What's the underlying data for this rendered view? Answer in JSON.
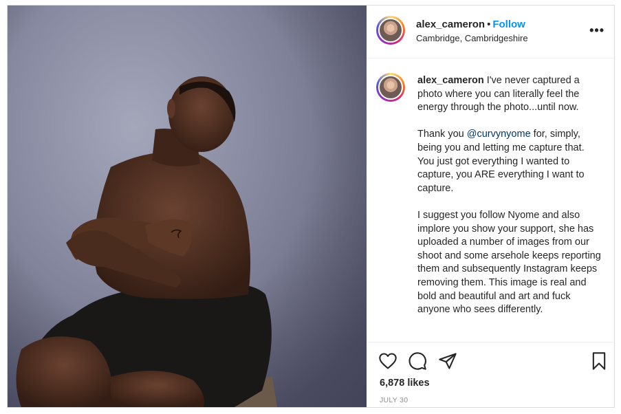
{
  "header": {
    "username": "alex_cameron",
    "separator": "•",
    "follow_label": "Follow",
    "location": "Cambridge, Cambridgeshire",
    "more_label": "•••"
  },
  "caption": {
    "username": "alex_cameron",
    "p1": " I've never captured a photo where you can literally feel the energy through the photo...until now.",
    "p2_before": "Thank you ",
    "mention": "@curvynyome",
    "p2_after": " for, simply, being you and letting me capture that. You just got everything I wanted to capture, you ARE everything I want to capture.",
    "p3": "I suggest you follow Nyome and also implore you show your support, she has uploaded a number of images from our shoot and some arsehole keeps reporting them and subsequently Instagram keeps removing them. This image is real and bold and beautiful and art and fuck anyone who sees differently."
  },
  "stats": {
    "likes": "6,878 likes",
    "date": "JULY 30"
  },
  "icons": {
    "like": "heart-icon",
    "comment": "comment-icon",
    "share": "paper-plane-icon",
    "save": "bookmark-icon",
    "more": "more-dots-icon"
  },
  "colors": {
    "accent": "#0095f6",
    "mention": "#00376b",
    "text": "#262626",
    "muted": "#8e8e8e",
    "border": "#dbdbdb"
  }
}
